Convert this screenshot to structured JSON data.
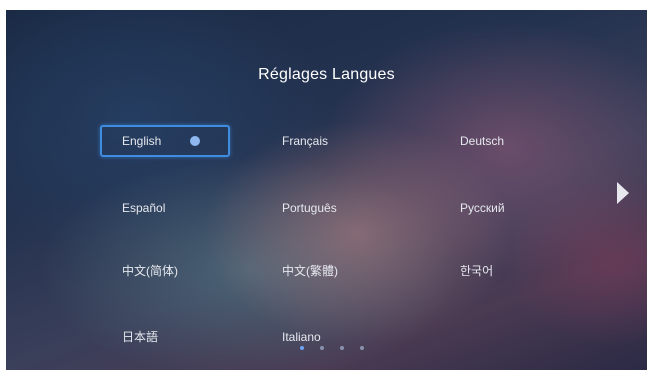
{
  "title": "Réglages Langues",
  "languages": [
    {
      "label": "English",
      "selected": true
    },
    {
      "label": "Français",
      "selected": false
    },
    {
      "label": "Deutsch",
      "selected": false
    },
    {
      "label": "Español",
      "selected": false
    },
    {
      "label": "Português",
      "selected": false
    },
    {
      "label": "Русский",
      "selected": false
    },
    {
      "label": "中文(简体)",
      "selected": false
    },
    {
      "label": "中文(繁體)",
      "selected": false
    },
    {
      "label": "한국어",
      "selected": false
    },
    {
      "label": "日本語",
      "selected": false
    },
    {
      "label": "Italiano",
      "selected": false
    }
  ],
  "pager": {
    "count": 4,
    "active_index": 0
  },
  "colors": {
    "accent": "#3f8de0",
    "selected_dot": "#8fb8f0",
    "text": "#e6e8ee"
  },
  "icons": {
    "next_page": "chevron-right-icon",
    "selected_marker": "radio-selected-icon"
  }
}
